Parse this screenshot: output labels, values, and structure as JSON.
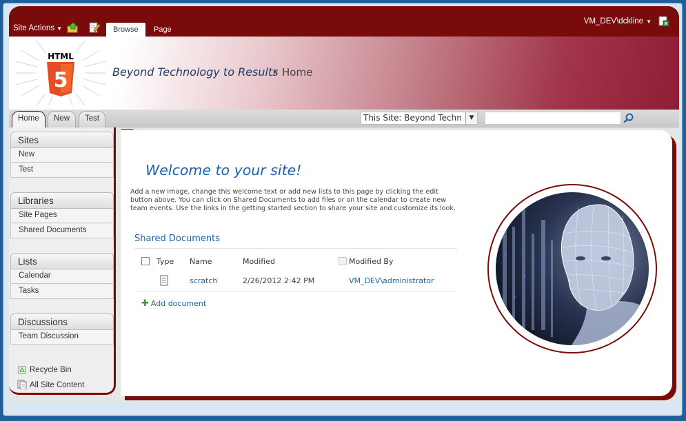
{
  "ribbon": {
    "site_actions": "Site Actions",
    "tabs": [
      {
        "label": "Browse",
        "active": true
      },
      {
        "label": "Page",
        "active": false
      }
    ],
    "user": "VM_DEV\\dckline",
    "icons": [
      "navigate-up-icon",
      "edit-page-icon",
      "user-settings-icon"
    ]
  },
  "header": {
    "logo_text": "HTML",
    "logo_digit": "5",
    "site_title": "Beyond Technology to Results",
    "breadcrumb_current": "Home"
  },
  "topnav": {
    "tabs": [
      {
        "label": "Home",
        "active": true
      },
      {
        "label": "New",
        "active": false
      },
      {
        "label": "Test",
        "active": false
      }
    ],
    "scope_value": "This Site: Beyond Techn",
    "search_value": ""
  },
  "quick_launch": {
    "groups": [
      {
        "heading": "Sites",
        "items": [
          "New",
          "Test"
        ]
      },
      {
        "heading": "Libraries",
        "items": [
          "Site Pages",
          "Shared Documents"
        ]
      },
      {
        "heading": "Lists",
        "items": [
          "Calendar",
          "Tasks"
        ]
      },
      {
        "heading": "Discussions",
        "items": [
          "Team Discussion"
        ]
      }
    ],
    "recycle_bin": "Recycle Bin",
    "all_site_content": "All Site Content"
  },
  "content": {
    "welcome": "Welcome to your site!",
    "blurb": "Add a new image, change this welcome text or add new lists to this page by clicking the edit button above. You can click on Shared Documents to add files or on the calendar to create new team events. Use the links in the getting started section to share your site and customize its look.",
    "webpart": {
      "title": "Shared Documents",
      "columns": {
        "type": "Type",
        "name": "Name",
        "modified": "Modified",
        "modified_by": "Modified By"
      },
      "rows": [
        {
          "name": "scratch",
          "modified": "2/26/2012 2:42 PM",
          "modified_by": "VM_DEV\\administrator"
        }
      ],
      "add_document": "Add document"
    }
  },
  "colors": {
    "accent": "#7a0b0b",
    "link": "#1f62a8",
    "html5_orange": "#e44d26"
  }
}
